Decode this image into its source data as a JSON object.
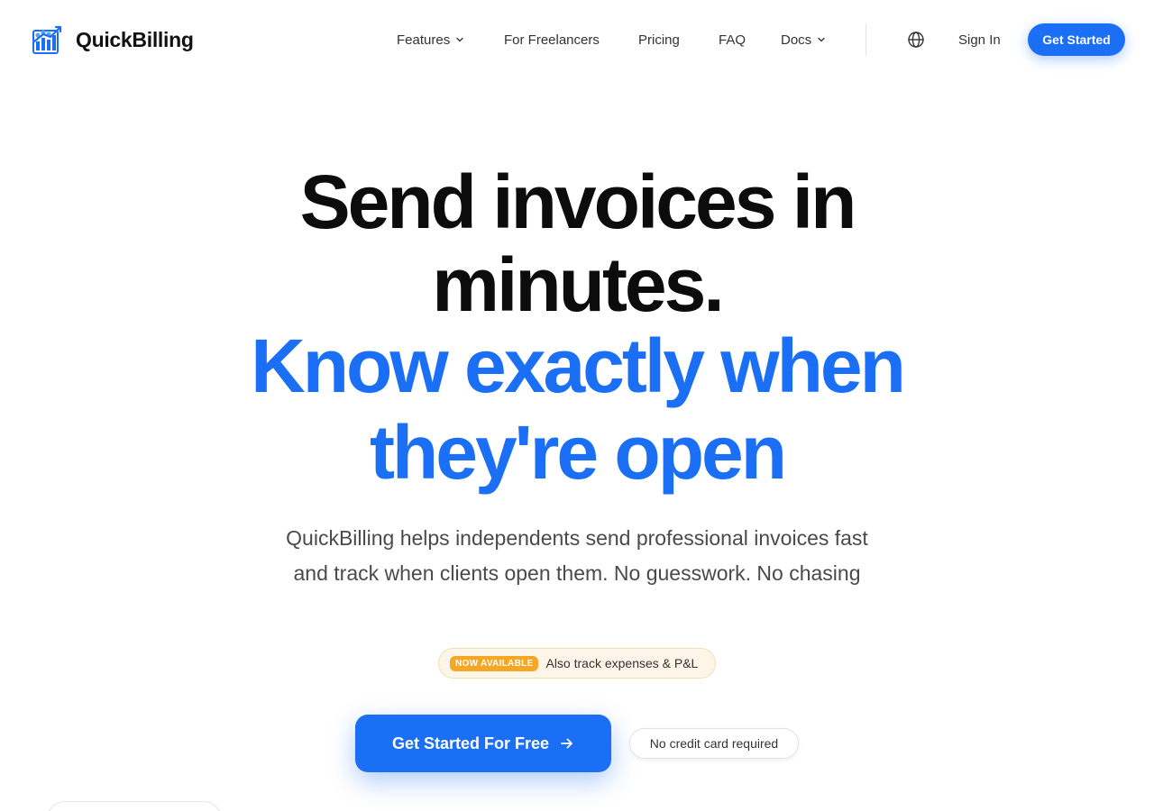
{
  "brand": {
    "name": "QuickBilling",
    "accent": "#1a6ff5",
    "logo_icon": "quickbilling-logo-icon"
  },
  "nav": {
    "items": [
      {
        "label": "Features",
        "has_dropdown": true
      },
      {
        "label": "For Freelancers",
        "has_dropdown": false
      },
      {
        "label": "Pricing",
        "has_dropdown": false
      },
      {
        "label": "FAQ",
        "has_dropdown": false
      },
      {
        "label": "Docs",
        "has_dropdown": true
      }
    ],
    "language_icon": "globe-icon",
    "sign_in": "Sign In",
    "cta": "Get Started"
  },
  "hero": {
    "headline_line1": "Send invoices in",
    "headline_line2": "minutes.",
    "highlight_line1": "Know exactly when",
    "highlight_line2": "they're open",
    "subtitle": "QuickBilling helps independents send professional invoices fast and track when clients open them. No guesswork. No chasing",
    "badge": {
      "tag": "NOW AVAILABLE",
      "text": "Also track expenses & P&L",
      "tag_color": "#f5a623"
    },
    "cta": "Get Started For Free",
    "cta_icon": "arrow-right-icon",
    "note": "No credit card required"
  }
}
